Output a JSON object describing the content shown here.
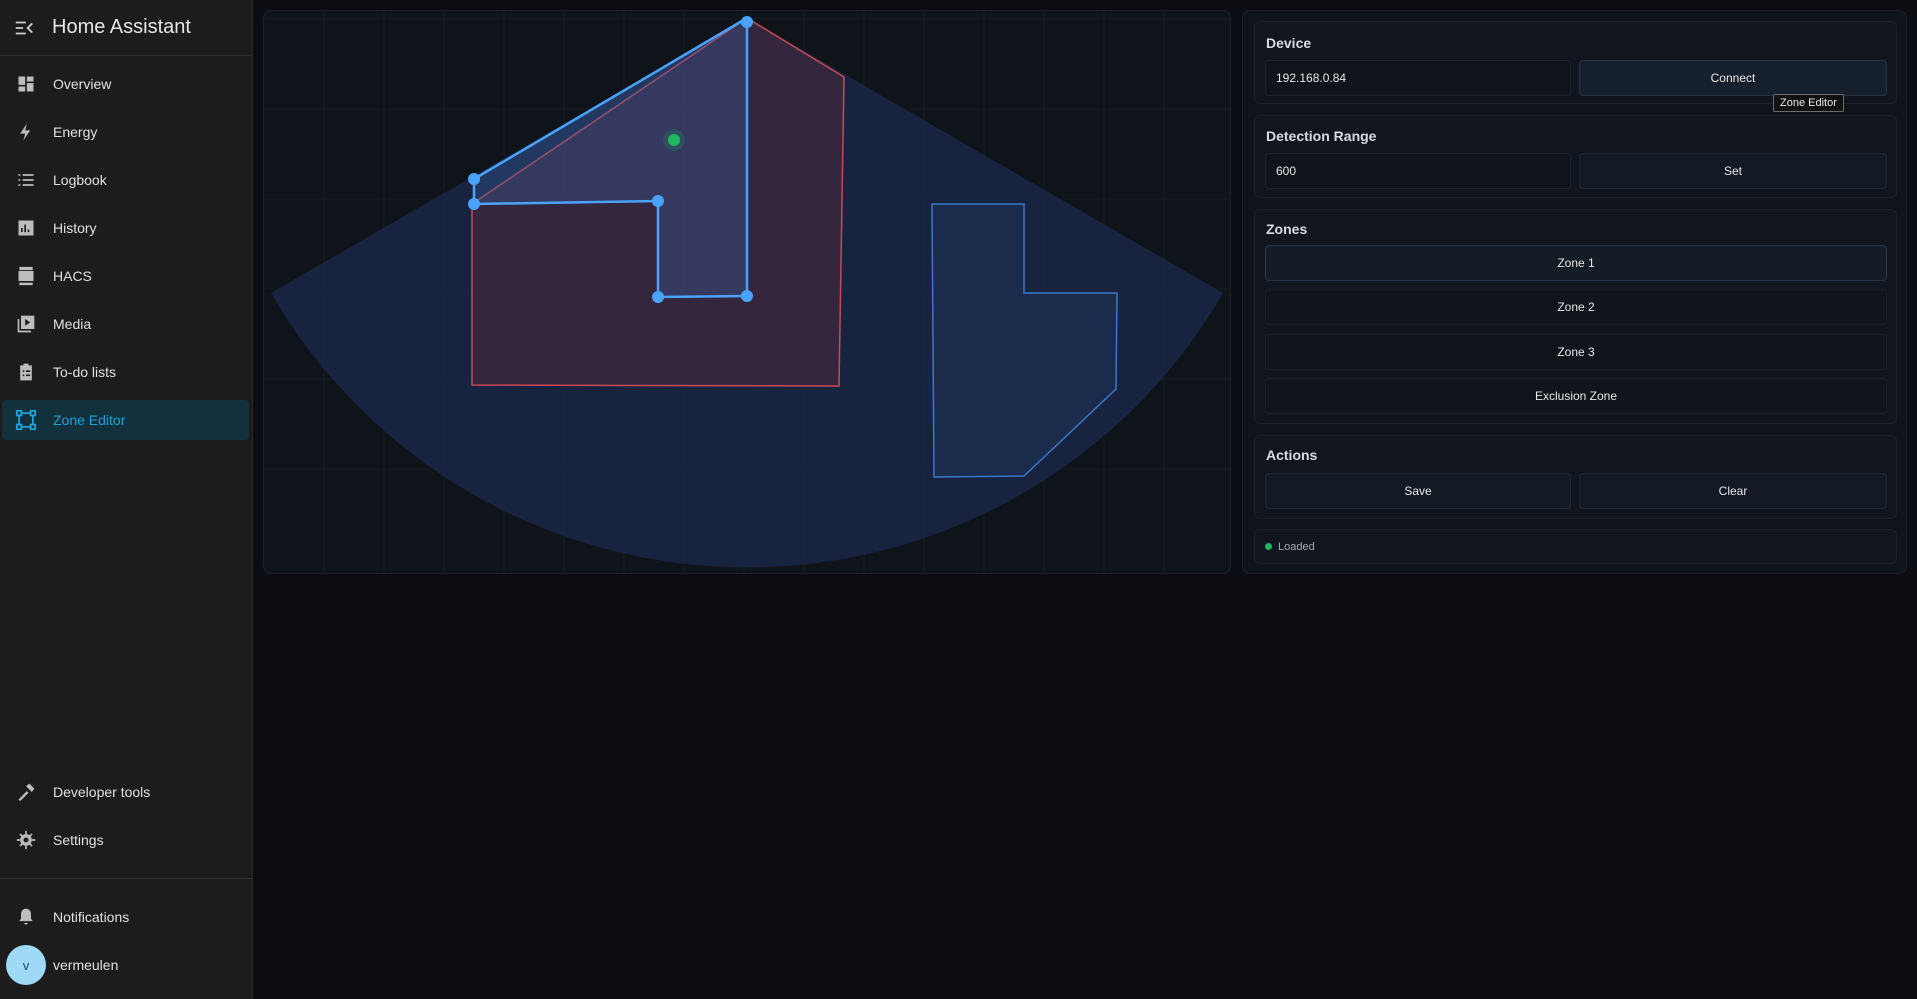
{
  "app": {
    "title": "Home Assistant"
  },
  "sidebar": {
    "items": [
      {
        "label": "Overview",
        "icon": "dashboard-icon"
      },
      {
        "label": "Energy",
        "icon": "lightning-icon"
      },
      {
        "label": "Logbook",
        "icon": "list-icon"
      },
      {
        "label": "History",
        "icon": "chart-icon"
      },
      {
        "label": "HACS",
        "icon": "hacs-icon"
      },
      {
        "label": "Media",
        "icon": "media-icon"
      },
      {
        "label": "To-do lists",
        "icon": "clipboard-icon"
      },
      {
        "label": "Zone Editor",
        "icon": "zone-editor-icon",
        "active": true
      }
    ],
    "bottom": [
      {
        "label": "Developer tools",
        "icon": "hammer-icon"
      },
      {
        "label": "Settings",
        "icon": "gear-icon"
      }
    ],
    "notifications_label": "Notifications",
    "user": {
      "name": "vermeulen",
      "initial": "v"
    }
  },
  "device": {
    "title": "Device",
    "address": "192.168.0.84",
    "connect_label": "Connect"
  },
  "tooltip": "Zone Editor",
  "detection_range": {
    "title": "Detection Range",
    "value": "600",
    "set_label": "Set"
  },
  "zones": {
    "title": "Zones",
    "items": [
      "Zone 1",
      "Zone 2",
      "Zone 3",
      "Exclusion Zone"
    ]
  },
  "actions": {
    "title": "Actions",
    "save_label": "Save",
    "clear_label": "Clear"
  },
  "status": {
    "text": "Loaded"
  },
  "colors": {
    "accent": "#1ea3d6",
    "zone_blue": "#4aa3ff",
    "zone_red": "#c94a55",
    "target": "#1fb860"
  }
}
